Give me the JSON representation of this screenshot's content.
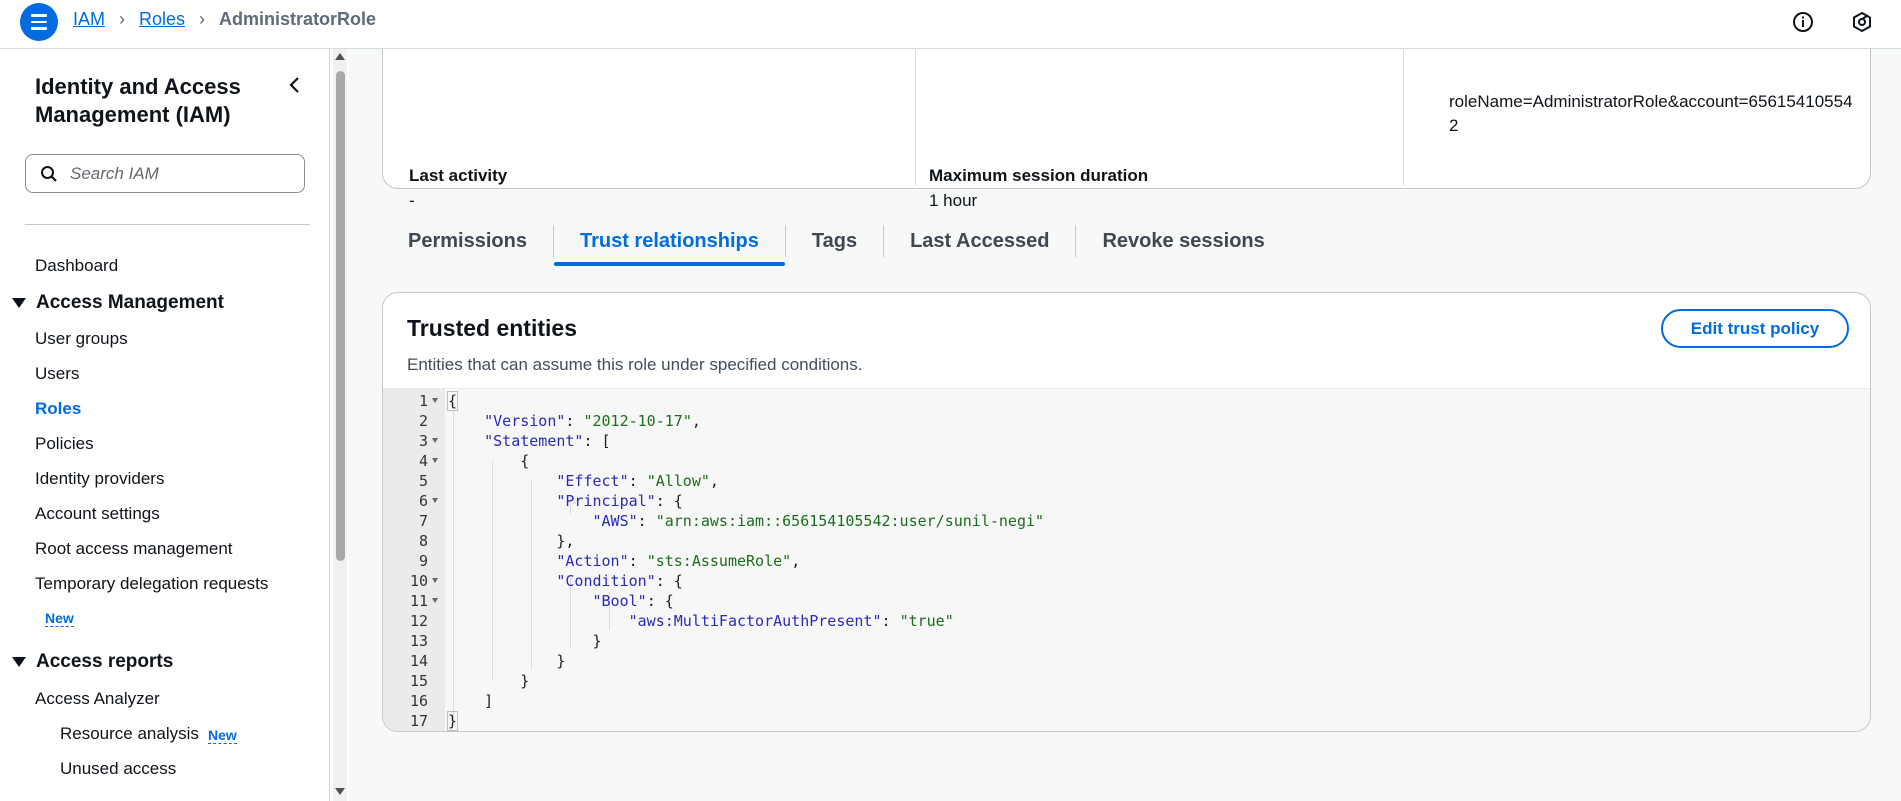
{
  "breadcrumb": {
    "items": [
      "IAM",
      "Roles"
    ],
    "current": "AdministratorRole"
  },
  "sidebar": {
    "title": "Identity and Access Management (IAM)",
    "search_placeholder": "Search IAM",
    "dashboard": "Dashboard",
    "section_access_management": "Access Management",
    "access_items": [
      "User groups",
      "Users",
      "Roles",
      "Policies",
      "Identity providers",
      "Account settings",
      "Root access management",
      "Temporary delegation requests"
    ],
    "new_badge": "New",
    "section_access_reports": "Access reports",
    "report_items": {
      "analyzer": "Access Analyzer",
      "resource": "Resource analysis",
      "unused": "Unused access"
    }
  },
  "summary": {
    "arn_fragment_1": "roleName=AdministratorRole&account=65615410554",
    "arn_fragment_2": "2",
    "last_activity_label": "Last activity",
    "last_activity_value": "-",
    "max_session_label": "Maximum session duration",
    "max_session_value": "1 hour"
  },
  "tabs": [
    "Permissions",
    "Trust relationships",
    "Tags",
    "Last Accessed",
    "Revoke sessions"
  ],
  "active_tab": "Trust relationships",
  "trusted_entities": {
    "title": "Trusted entities",
    "description": "Entities that can assume this role under specified conditions.",
    "edit_button": "Edit trust policy"
  },
  "policy": {
    "version": "2012-10-17",
    "effect": "Allow",
    "principal_aws": "arn:aws:iam::656154105542:user/sunil-negi",
    "action": "sts:AssumeRole",
    "condition_key": "aws:MultiFactorAuthPresent",
    "condition_value": "true"
  },
  "colors": {
    "accent": "#006ce0",
    "text": "#0f141a"
  }
}
